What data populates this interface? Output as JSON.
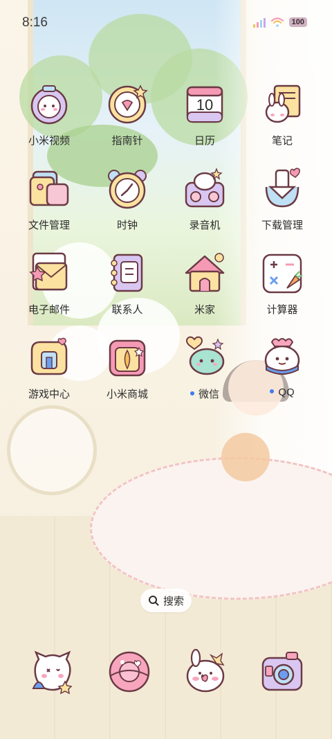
{
  "status_bar": {
    "time": "8:16",
    "battery": "100",
    "icons": [
      "signal-icon",
      "wifi-icon",
      "battery-icon"
    ]
  },
  "apps": [
    {
      "label": "小米视频",
      "icon": "xiaomi-video-icon",
      "dot": false
    },
    {
      "label": "指南针",
      "icon": "compass-icon",
      "dot": false
    },
    {
      "label": "日历",
      "icon": "calendar-icon",
      "dot": false,
      "icon_text": "10"
    },
    {
      "label": "笔记",
      "icon": "notes-icon",
      "dot": false
    },
    {
      "label": "文件管理",
      "icon": "file-manager-icon",
      "dot": false
    },
    {
      "label": "时钟",
      "icon": "clock-icon",
      "dot": false
    },
    {
      "label": "录音机",
      "icon": "recorder-icon",
      "dot": false
    },
    {
      "label": "下载管理",
      "icon": "download-manager-icon",
      "dot": false
    },
    {
      "label": "电子邮件",
      "icon": "email-icon",
      "dot": false
    },
    {
      "label": "联系人",
      "icon": "contacts-icon",
      "dot": false
    },
    {
      "label": "米家",
      "icon": "mijia-icon",
      "dot": false
    },
    {
      "label": "计算器",
      "icon": "calculator-icon",
      "dot": false
    },
    {
      "label": "游戏中心",
      "icon": "game-center-icon",
      "dot": false
    },
    {
      "label": "小米商城",
      "icon": "xiaomi-store-icon",
      "dot": false
    },
    {
      "label": "微信",
      "icon": "wechat-icon",
      "dot": true
    },
    {
      "label": "QQ",
      "icon": "qq-icon",
      "dot": true
    }
  ],
  "search": {
    "label": "搜索",
    "icon": "search-icon"
  },
  "dock": [
    {
      "icon": "phone-icon"
    },
    {
      "icon": "messages-icon"
    },
    {
      "icon": "browser-icon"
    },
    {
      "icon": "camera-icon"
    }
  ],
  "colors": {
    "label_text": "#2d2d2d",
    "notification_dot": "#3d7cf0",
    "icon_outline": "#6b3a44",
    "icon_pink": "#f7c7d6",
    "icon_yellow": "#fbe2a0",
    "icon_purple": "#d9c7f2",
    "icon_blue": "#bfe0f5"
  }
}
